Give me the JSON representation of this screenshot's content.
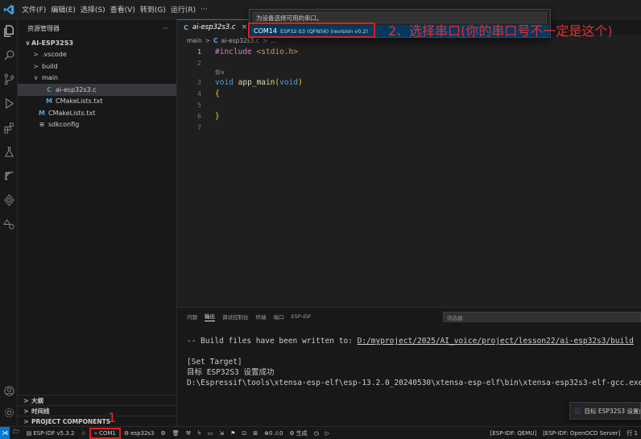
{
  "titlebar": {
    "menus": [
      "文件(F)",
      "编辑(E)",
      "选择(S)",
      "查看(V)",
      "转到(G)",
      "运行(R)",
      "···"
    ]
  },
  "sidebar": {
    "title": "资源管理器",
    "more": "···",
    "project": "AI-ESP32S3",
    "items": [
      {
        "label": ".vscode",
        "chev": ">",
        "icon": ""
      },
      {
        "label": "build",
        "chev": ">",
        "icon": ""
      },
      {
        "label": "main",
        "chev": "∨",
        "icon": ""
      },
      {
        "label": "ai-esp32s3.c",
        "chev": "",
        "icon": "C"
      },
      {
        "label": "CMakeLists.txt",
        "chev": "",
        "icon": "M"
      },
      {
        "label": "CMakeLists.txt",
        "chev": "",
        "icon": "M"
      },
      {
        "label": "sdkconfig",
        "chev": "",
        "icon": "≡"
      }
    ],
    "bottom": [
      "大纲",
      "时间线",
      "PROJECT COMPONENTS"
    ]
  },
  "editor": {
    "tab": {
      "icon": "C",
      "label": "ai-esp32s3.c",
      "close": "×"
    },
    "breadcrumb": [
      "main",
      ">",
      "C",
      "ai-esp32s3.c",
      ">",
      "..."
    ],
    "codelens": "你∨",
    "lines": [
      {
        "n": "1",
        "kw": "#include",
        "rest": " <stdio.h>"
      },
      {
        "n": "2"
      },
      {
        "n": "3",
        "type": "void",
        "fn": "app_main",
        "args": "(",
        "argtype": "void",
        "close": ")"
      },
      {
        "n": "4",
        "brace": "{"
      },
      {
        "n": "5"
      },
      {
        "n": "6",
        "brace": "}"
      },
      {
        "n": "7"
      }
    ]
  },
  "quickpick": {
    "placeholder": "为设备选择可用的串口。",
    "item_label": "COM14",
    "item_desc": "ESP32-S3 (QFN56) (revision v0.2)"
  },
  "annotations": {
    "step2": "2、选择串口(你的串口号不一定是这个)",
    "step1": "1"
  },
  "panel": {
    "tabs": [
      "问题",
      "输出",
      "调试控制台",
      "终端",
      "端口",
      "ESP-IDF"
    ],
    "filter_placeholder": "筛选器",
    "output": {
      "line1_prefix": "-- Build files have been written to: ",
      "line1_link": "D:/myproject/2025/AI_voice/project/lesson22/ai-esp32s3/build",
      "line2": "[Set Target]",
      "line3": "目标 ESP32S3 设置成功",
      "line4": "D:\\Espressif\\tools\\xtensa-esp-elf\\esp-13.2.0_20240530\\xtensa-esp-elf\\bin\\xtensa-esp32s3-elf-gcc.exe"
    },
    "toast": "目标 ESP32S3 设置成功"
  },
  "statusbar": {
    "idf_version": "ESP-IDF v5.3.2",
    "port": "COM1",
    "target": "esp32s3",
    "problems": "⊗0 ⚠0",
    "build": "生成",
    "qemu": "[ESP-IDF: QEMU]",
    "openocd": "[ESP-IDF: OpenOCD Server]",
    "line_prefix": "行 1"
  },
  "colors": {
    "accent": "#0078d4",
    "annotation": "#e01e1e"
  }
}
